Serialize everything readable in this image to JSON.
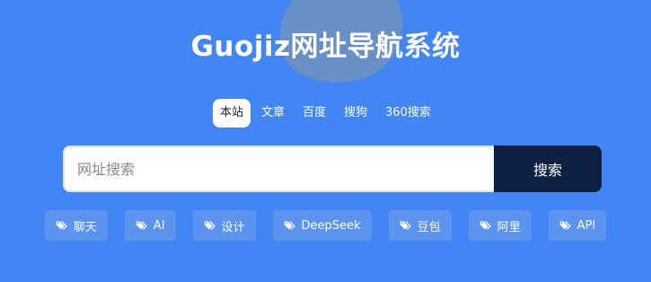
{
  "colors": {
    "background": "#4285f4",
    "blob": "#6b8fc4",
    "search_button": "#0f2142",
    "tag_background": "#5b93ef",
    "active_tab_background": "#ffffff"
  },
  "header": {
    "title": "Guojiz网址导航系统"
  },
  "search_engines": {
    "tabs": [
      {
        "label": "本站",
        "active": true
      },
      {
        "label": "文章",
        "active": false
      },
      {
        "label": "百度",
        "active": false
      },
      {
        "label": "搜狗",
        "active": false
      },
      {
        "label": "360搜索",
        "active": false
      }
    ]
  },
  "search": {
    "placeholder": "网址搜索",
    "value": "",
    "button_label": "搜索"
  },
  "tags": {
    "icon": "tag-icon",
    "items": [
      {
        "label": "聊天"
      },
      {
        "label": "AI"
      },
      {
        "label": "设计"
      },
      {
        "label": "DeepSeek"
      },
      {
        "label": "豆包"
      },
      {
        "label": "阿里"
      },
      {
        "label": "API"
      }
    ]
  }
}
